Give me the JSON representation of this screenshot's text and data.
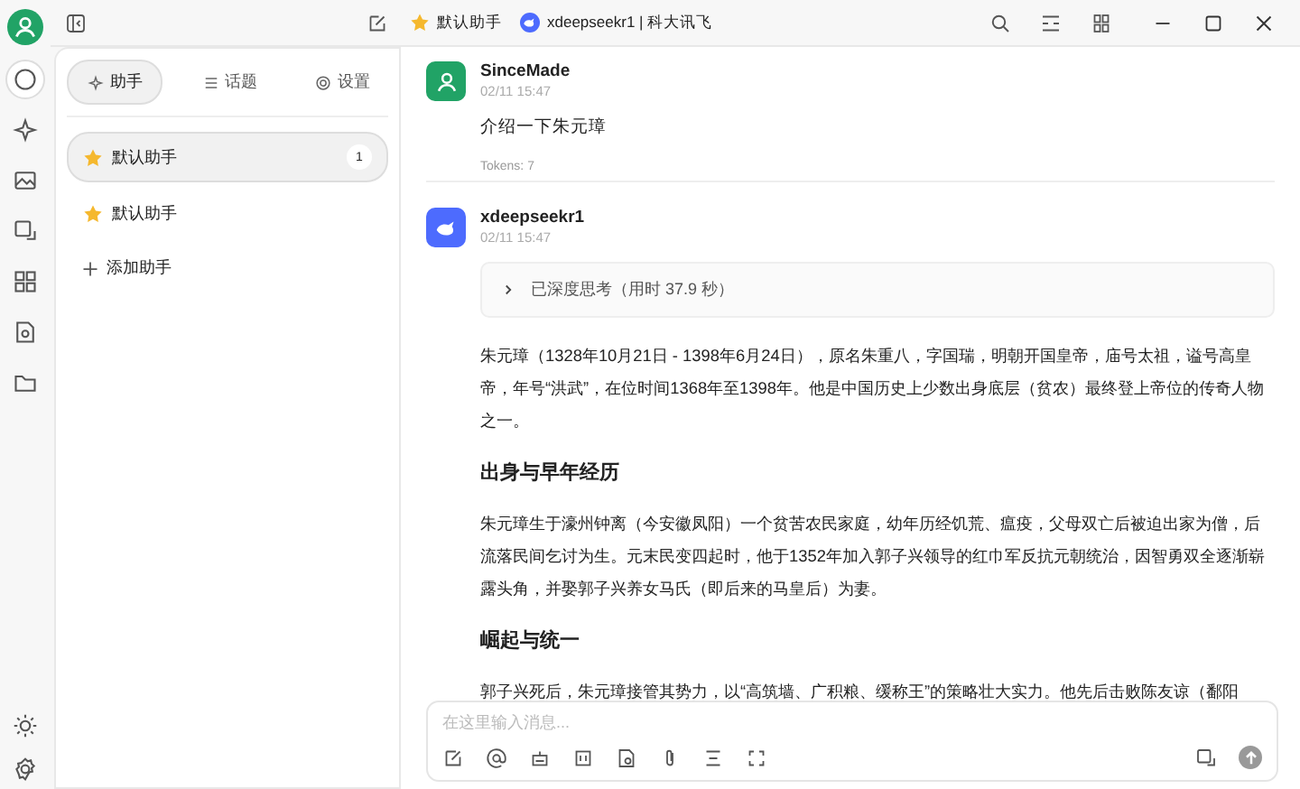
{
  "titlebar": {
    "assistant": "默认助手",
    "model": "xdeepseekr1 | 科大讯飞"
  },
  "rail": {
    "items": [
      {
        "kind": "chat",
        "selected": true
      },
      {
        "kind": "sparkle",
        "selected": false
      },
      {
        "kind": "image",
        "selected": false
      },
      {
        "kind": "translate",
        "selected": false
      },
      {
        "kind": "apps",
        "selected": false
      },
      {
        "kind": "files",
        "selected": false
      },
      {
        "kind": "folder",
        "selected": false
      }
    ]
  },
  "sidebar": {
    "tabs": [
      {
        "label": "助手",
        "kind": "assistant",
        "selected": true
      },
      {
        "label": "话题",
        "kind": "topics",
        "selected": false
      },
      {
        "label": "设置",
        "kind": "settings",
        "selected": false
      }
    ],
    "items": [
      {
        "label": "默认助手",
        "count": "1",
        "selected": true
      },
      {
        "label": "默认助手",
        "selected": false
      }
    ],
    "add": "添加助手"
  },
  "messages": [
    {
      "kind": "user",
      "author": "SinceMade",
      "time": "02/11 15:47",
      "text": "介绍一下朱元璋",
      "tokens": "Tokens: 7"
    },
    {
      "kind": "bot",
      "author": "xdeepseekr1",
      "time": "02/11 15:47",
      "thinking": "已深度思考（用时 37.9 秒）",
      "blocks": [
        {
          "kind": "p",
          "text": "朱元璋（1328年10月21日 - 1398年6月24日），原名朱重八，字国瑞，明朝开国皇帝，庙号太祖，谥号高皇帝，年号“洪武”，在位时间1368年至1398年。他是中国历史上少数出身底层（贫农）最终登上帝位的传奇人物之一。"
        },
        {
          "kind": "h",
          "text": "出身与早年经历"
        },
        {
          "kind": "p",
          "text": "朱元璋生于濠州钟离（今安徽凤阳）一个贫苦农民家庭，幼年历经饥荒、瘟疫，父母双亡后被迫出家为僧，后流落民间乞讨为生。元末民变四起时，他于1352年加入郭子兴领导的红巾军反抗元朝统治，因智勇双全逐渐崭露头角，并娶郭子兴养女马氏（即后来的马皇后）为妻。"
        },
        {
          "kind": "h",
          "text": "崛起与统一"
        },
        {
          "kind": "p",
          "text": "郭子兴死后，朱元璋接管其势力，以“高筑墙、广积粮、缓称王”的策略壮大实力。他先后击败陈友谅（鄱阳"
        }
      ]
    }
  ],
  "composer": {
    "placeholder": "在这里输入消息..."
  }
}
